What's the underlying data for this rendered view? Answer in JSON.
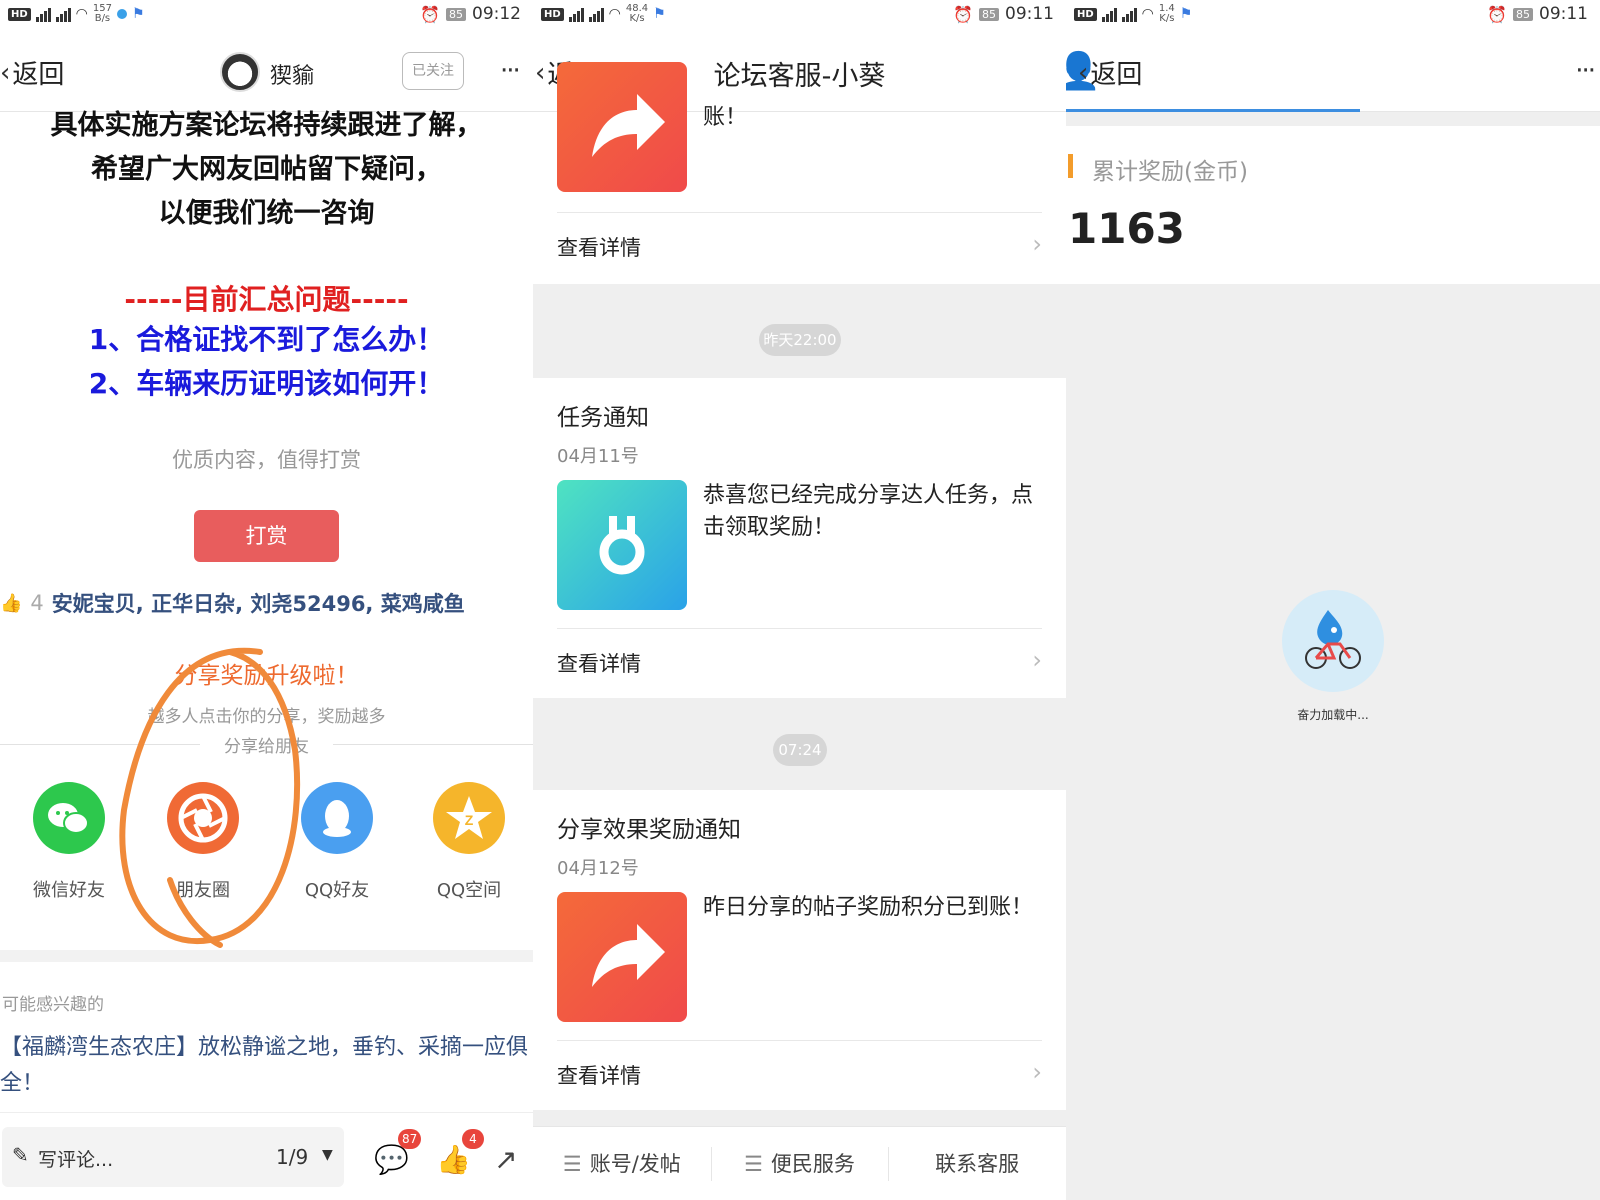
{
  "panel1": {
    "status": {
      "hd": "HD",
      "net": "46",
      "speed_value": "157",
      "speed_unit": "B/s",
      "battery": "85",
      "time": "09:12"
    },
    "nav": {
      "back_label": "返回",
      "username": "猰貐",
      "follow_label": "已关注",
      "more": "···"
    },
    "article": {
      "line1": "具体实施方案论坛将持续跟进了解，",
      "line2": "希望广大网友回帖留下疑问，",
      "line3": "以便我们统一咨询",
      "section_title": "-----目前汇总问题-----",
      "q1": "1、合格证找不到了怎么办！",
      "q2": "2、车辆来历证明该如何开！"
    },
    "reward": {
      "hint": "优质内容，值得打赏",
      "button": "打赏"
    },
    "likes": {
      "count": "4",
      "users": "安妮宝贝, 正华日杂, 刘尧52496, 菜鸡咸鱼"
    },
    "share": {
      "title": "分享奖励升级啦！",
      "subtitle": "越多人点击你的分享，奖励越多",
      "to_label": "分享给朋友",
      "items": [
        {
          "label": "微信好友",
          "icon": "wechat-icon",
          "color": "#2dc84d"
        },
        {
          "label": "朋友圈",
          "icon": "moments-icon",
          "color": "#f06a35"
        },
        {
          "label": "QQ好友",
          "icon": "qq-icon",
          "color": "#4a9ff0"
        },
        {
          "label": "QQ空间",
          "icon": "qzone-icon",
          "color": "#f5b52b"
        }
      ]
    },
    "recommend": {
      "title": "可能感兴趣的",
      "link": "【福麟湾生态农庄】放松静谧之地，垂钓、采摘一应俱全！"
    },
    "bottom": {
      "comment_placeholder": "写评论...",
      "page": "1/9",
      "comment_badge": "87",
      "like_badge": "4"
    }
  },
  "panel2": {
    "status": {
      "hd": "HD",
      "speed_value": "48.4",
      "speed_unit": "K/s",
      "battery": "85",
      "time": "09:11"
    },
    "nav": {
      "back_label": "返回",
      "title": "论坛客服-小葵"
    },
    "top_card": {
      "text_tail": "账！",
      "detail": "查看详情"
    },
    "time1": "昨天22:00",
    "card1": {
      "title": "任务通知",
      "date": "04月11号",
      "text": "恭喜您已经完成分享达人任务，点击领取奖励！",
      "detail": "查看详情",
      "icon": "medal-icon"
    },
    "time2": "07:24",
    "card2": {
      "title": "分享效果奖励通知",
      "date": "04月12号",
      "text": "昨日分享的帖子奖励积分已到账！",
      "detail": "查看详情",
      "icon": "share-arrow-icon"
    },
    "bottom_tabs": [
      {
        "label": "账号/发帖",
        "menu": "☰"
      },
      {
        "label": "便民服务",
        "menu": "☰"
      },
      {
        "label": "联系客服",
        "menu": ""
      }
    ]
  },
  "panel3": {
    "status": {
      "hd": "HD",
      "speed_value": "1.4",
      "speed_unit": "K/s",
      "battery": "85",
      "time": "09:11"
    },
    "nav": {
      "back_label": "返回",
      "more": "···"
    },
    "reward": {
      "label": "累计奖励(金币)",
      "value": "1163"
    },
    "loading_text": "奋力加载中..."
  },
  "colors": {
    "accent_red": "#e85d5d",
    "link_blue": "#35507e",
    "share_orange": "#ee6a2f",
    "progress_blue": "#3d8ee0"
  }
}
